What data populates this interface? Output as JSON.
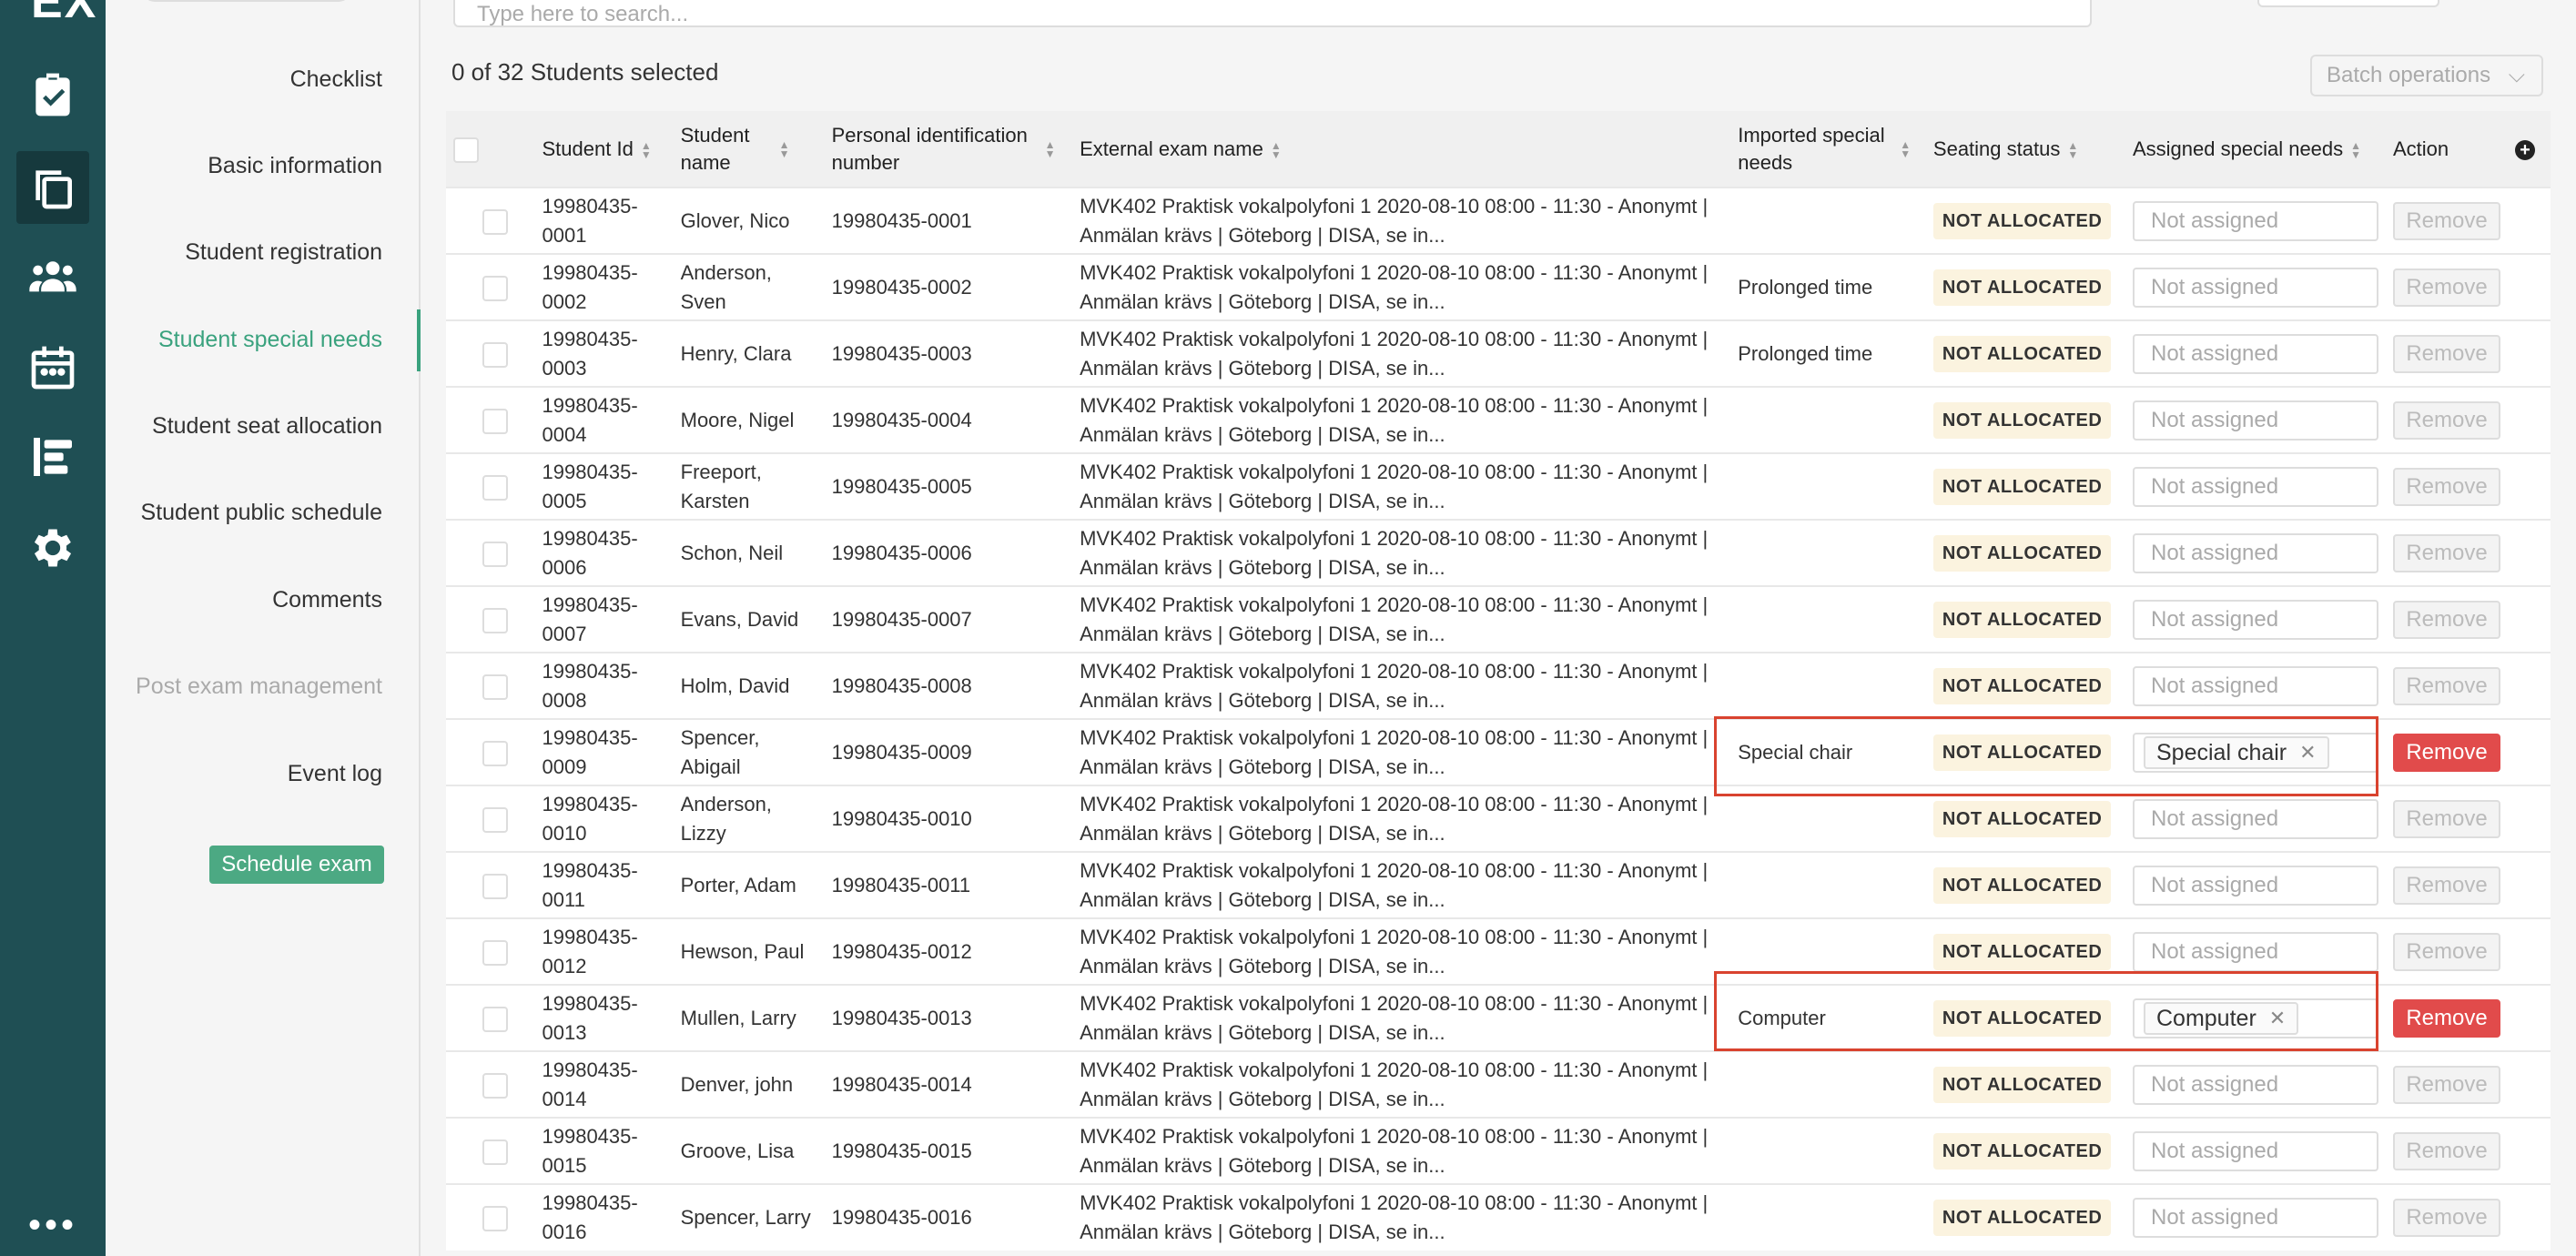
{
  "app": {
    "logo": "EX"
  },
  "rail": [
    {
      "name": "checklist-icon"
    },
    {
      "name": "copy-icon"
    },
    {
      "name": "users-icon"
    },
    {
      "name": "calendar-icon"
    },
    {
      "name": "list-icon"
    },
    {
      "name": "gear-icon"
    }
  ],
  "rail_more": "•••",
  "subnav": {
    "items": [
      {
        "label": "Checklist"
      },
      {
        "label": "Basic information"
      },
      {
        "label": "Student registration"
      },
      {
        "label": "Student special needs"
      },
      {
        "label": "Student seat allocation"
      },
      {
        "label": "Student public schedule"
      },
      {
        "label": "Comments"
      },
      {
        "label": "Post exam management"
      },
      {
        "label": "Event log"
      }
    ],
    "schedule_button": "Schedule exam"
  },
  "search": {
    "placeholder": "Type here to search..."
  },
  "selection": {
    "count_text": "0 of 32 Students selected"
  },
  "batch": {
    "label": "Batch operations"
  },
  "table": {
    "headers": {
      "student_id": "Student Id",
      "student_name": "Student name",
      "personal_id": "Personal identification number",
      "exam_name": "External exam name",
      "imported_needs": "Imported special needs",
      "seating": "Seating status",
      "assigned": "Assigned special needs",
      "action": "Action"
    },
    "remove_label": "Remove",
    "not_assigned": "Not assigned",
    "rows": [
      {
        "id": "19980435-0001",
        "name": "Glover, Nico",
        "pin": "19980435-0001",
        "exam": "MVK402 Praktisk vokalpolyfoni 1 2020-08-10 08:00 - 11:30 - Anonymt | Anmälan krävs | Göteborg | DISA, se in...",
        "imported": "",
        "seating": "NOT ALLOCATED",
        "assigned": ""
      },
      {
        "id": "19980435-0002",
        "name": "Anderson, Sven",
        "pin": "19980435-0002",
        "exam": "MVK402 Praktisk vokalpolyfoni 1 2020-08-10 08:00 - 11:30 - Anonymt | Anmälan krävs | Göteborg | DISA, se in...",
        "imported": "Prolonged time",
        "seating": "NOT ALLOCATED",
        "assigned": ""
      },
      {
        "id": "19980435-0003",
        "name": "Henry, Clara",
        "pin": "19980435-0003",
        "exam": "MVK402 Praktisk vokalpolyfoni 1 2020-08-10 08:00 - 11:30 - Anonymt | Anmälan krävs | Göteborg | DISA, se in...",
        "imported": "Prolonged time",
        "seating": "NOT ALLOCATED",
        "assigned": ""
      },
      {
        "id": "19980435-0004",
        "name": "Moore, Nigel",
        "pin": "19980435-0004",
        "exam": "MVK402 Praktisk vokalpolyfoni 1 2020-08-10 08:00 - 11:30 - Anonymt | Anmälan krävs | Göteborg | DISA, se in...",
        "imported": "",
        "seating": "NOT ALLOCATED",
        "assigned": ""
      },
      {
        "id": "19980435-0005",
        "name": "Freeport, Karsten",
        "pin": "19980435-0005",
        "exam": "MVK402 Praktisk vokalpolyfoni 1 2020-08-10 08:00 - 11:30 - Anonymt | Anmälan krävs | Göteborg | DISA, se in...",
        "imported": "",
        "seating": "NOT ALLOCATED",
        "assigned": ""
      },
      {
        "id": "19980435-0006",
        "name": "Schon, Neil",
        "pin": "19980435-0006",
        "exam": "MVK402 Praktisk vokalpolyfoni 1 2020-08-10 08:00 - 11:30 - Anonymt | Anmälan krävs | Göteborg | DISA, se in...",
        "imported": "",
        "seating": "NOT ALLOCATED",
        "assigned": ""
      },
      {
        "id": "19980435-0007",
        "name": "Evans, David",
        "pin": "19980435-0007",
        "exam": "MVK402 Praktisk vokalpolyfoni 1 2020-08-10 08:00 - 11:30 - Anonymt | Anmälan krävs | Göteborg | DISA, se in...",
        "imported": "",
        "seating": "NOT ALLOCATED",
        "assigned": ""
      },
      {
        "id": "19980435-0008",
        "name": "Holm, David",
        "pin": "19980435-0008",
        "exam": "MVK402 Praktisk vokalpolyfoni 1 2020-08-10 08:00 - 11:30 - Anonymt | Anmälan krävs | Göteborg | DISA, se in...",
        "imported": "",
        "seating": "NOT ALLOCATED",
        "assigned": ""
      },
      {
        "id": "19980435-0009",
        "name": "Spencer, Abigail",
        "pin": "19980435-0009",
        "exam": "MVK402 Praktisk vokalpolyfoni 1 2020-08-10 08:00 - 11:30 - Anonymt | Anmälan krävs | Göteborg | DISA, se in...",
        "imported": "Special chair",
        "seating": "NOT ALLOCATED",
        "assigned": "Special chair"
      },
      {
        "id": "19980435-0010",
        "name": "Anderson, Lizzy",
        "pin": "19980435-0010",
        "exam": "MVK402 Praktisk vokalpolyfoni 1 2020-08-10 08:00 - 11:30 - Anonymt | Anmälan krävs | Göteborg | DISA, se in...",
        "imported": "",
        "seating": "NOT ALLOCATED",
        "assigned": ""
      },
      {
        "id": "19980435-0011",
        "name": "Porter, Adam",
        "pin": "19980435-0011",
        "exam": "MVK402 Praktisk vokalpolyfoni 1 2020-08-10 08:00 - 11:30 - Anonymt | Anmälan krävs | Göteborg | DISA, se in...",
        "imported": "",
        "seating": "NOT ALLOCATED",
        "assigned": ""
      },
      {
        "id": "19980435-0012",
        "name": "Hewson, Paul",
        "pin": "19980435-0012",
        "exam": "MVK402 Praktisk vokalpolyfoni 1 2020-08-10 08:00 - 11:30 - Anonymt | Anmälan krävs | Göteborg | DISA, se in...",
        "imported": "",
        "seating": "NOT ALLOCATED",
        "assigned": ""
      },
      {
        "id": "19980435-0013",
        "name": "Mullen, Larry",
        "pin": "19980435-0013",
        "exam": "MVK402 Praktisk vokalpolyfoni 1 2020-08-10 08:00 - 11:30 - Anonymt | Anmälan krävs | Göteborg | DISA, se in...",
        "imported": "Computer",
        "seating": "NOT ALLOCATED",
        "assigned": "Computer"
      },
      {
        "id": "19980435-0014",
        "name": "Denver, john",
        "pin": "19980435-0014",
        "exam": "MVK402 Praktisk vokalpolyfoni 1 2020-08-10 08:00 - 11:30 - Anonymt | Anmälan krävs | Göteborg | DISA, se in...",
        "imported": "",
        "seating": "NOT ALLOCATED",
        "assigned": ""
      },
      {
        "id": "19980435-0015",
        "name": "Groove, Lisa",
        "pin": "19980435-0015",
        "exam": "MVK402 Praktisk vokalpolyfoni 1 2020-08-10 08:00 - 11:30 - Anonymt | Anmälan krävs | Göteborg | DISA, se in...",
        "imported": "",
        "seating": "NOT ALLOCATED",
        "assigned": ""
      },
      {
        "id": "19980435-0016",
        "name": "Spencer, Larry",
        "pin": "19980435-0016",
        "exam": "MVK402 Praktisk vokalpolyfoni 1 2020-08-10 08:00 - 11:30 - Anonymt | Anmälan krävs | Göteborg | DISA, se in...",
        "imported": "",
        "seating": "NOT ALLOCATED",
        "assigned": ""
      }
    ]
  },
  "colors": {
    "rail": "#1f4f54",
    "accent": "#3aa27e",
    "danger": "#e14b4b",
    "highlight": "#d9432f"
  }
}
